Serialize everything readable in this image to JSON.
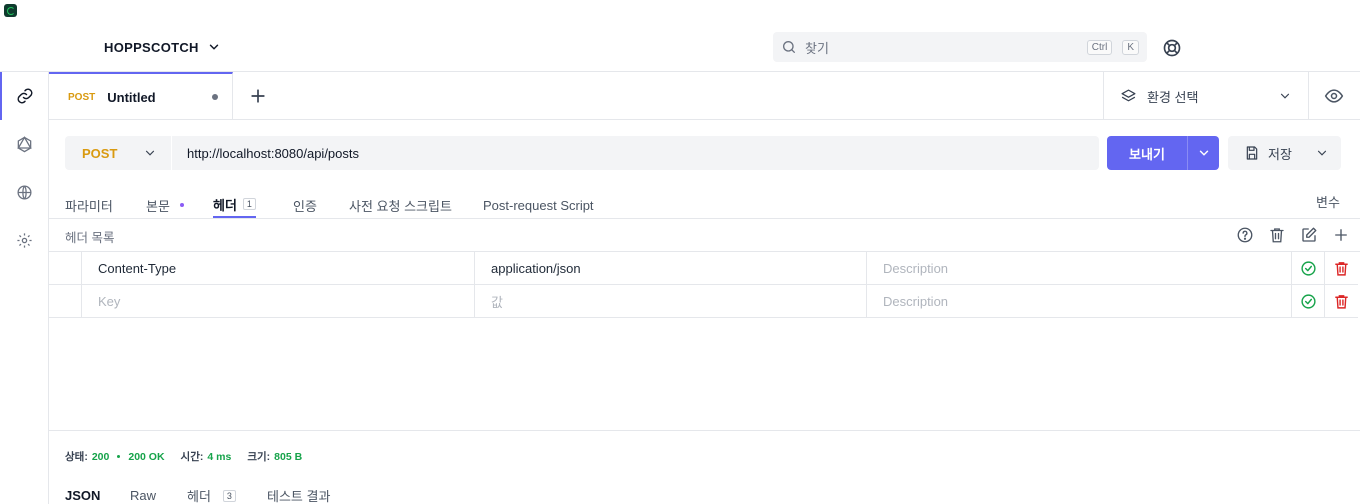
{
  "workspace": {
    "name": "HOPPSCOTCH"
  },
  "search": {
    "placeholder": "찾기",
    "shortcut_ctrl": "Ctrl",
    "shortcut_key": "K"
  },
  "tab": {
    "method": "POST",
    "title": "Untitled"
  },
  "environment": {
    "label": "환경 선택"
  },
  "request": {
    "method": "POST",
    "url": "http://localhost:8080/api/posts",
    "send_label": "보내기",
    "save_label": "저장"
  },
  "request_tabs": {
    "params": "파라미터",
    "body": "본문",
    "headers": "헤더",
    "headers_count": "1",
    "auth": "인증",
    "pre_request": "사전 요청 스크립트",
    "post_request": "Post-request Script",
    "variables": "변수"
  },
  "headers_list": {
    "title": "헤더 목록",
    "rows": [
      {
        "key": "Content-Type",
        "value": "application/json",
        "description": "Description"
      }
    ],
    "new_row": {
      "key_placeholder": "Key",
      "value_placeholder": "값",
      "description_placeholder": "Description"
    }
  },
  "response": {
    "status_label": "상태:",
    "status_code": "200",
    "status_text": "200 OK",
    "time_label": "시간:",
    "time_value": "4 ms",
    "size_label": "크기:",
    "size_value": "805 B",
    "tabs": {
      "json": "JSON",
      "raw": "Raw",
      "headers": "헤더",
      "headers_count": "3",
      "tests": "테스트 결과"
    }
  },
  "colors": {
    "accent": "#6366f1",
    "post_method": "#d99a10",
    "success": "#16a34a",
    "danger": "#dc2626"
  }
}
